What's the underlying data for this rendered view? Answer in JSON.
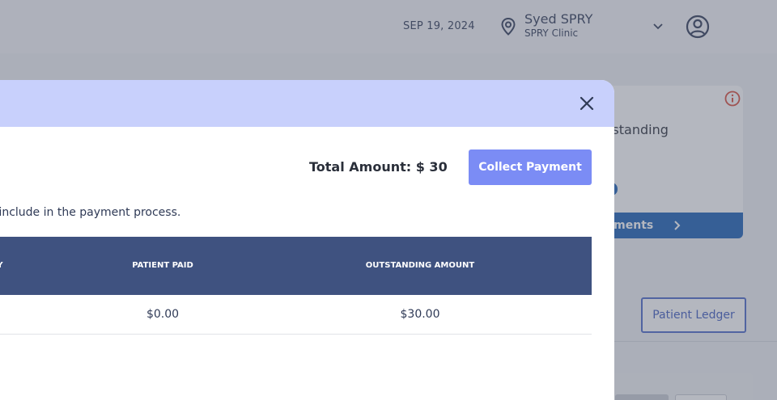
{
  "header": {
    "date": "SEP 19, 2024",
    "user_name": "Syed SPRY",
    "clinic": "SPRY Clinic"
  },
  "card": {
    "text": "utstanding",
    "link_label": "ayments"
  },
  "ledger_button": "Patient Ledger",
  "modal": {
    "total_amount": "Total Amount: $ 30",
    "collect_payment": "Collect Payment",
    "instruction": "t to include in the payment process.",
    "table": {
      "headers": [
        "Y",
        "PATIENT PAID",
        "OUTSTANDING AMOUNT"
      ],
      "rows": [
        {
          "patient_paid": "$0.00",
          "outstanding_amount": "$30.00"
        }
      ]
    }
  },
  "colors": {
    "modal_header": "#c8d0fc",
    "primary_button": "#7b8cf5",
    "table_header": "#3f5280",
    "card_bar": "#1a5fb4",
    "info_icon": "#d94a3a"
  },
  "icons": [
    "location-pin-icon",
    "chevron-down-icon",
    "user-avatar-icon",
    "info-icon",
    "chevron-right-icon",
    "close-icon"
  ]
}
